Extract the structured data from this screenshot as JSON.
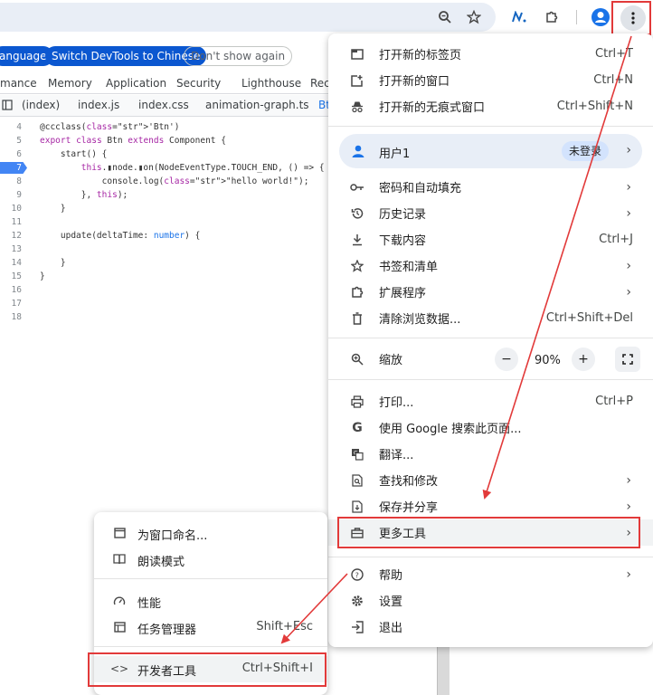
{
  "banner": {
    "set_language_label": "anguage",
    "switch_chinese_label": "Switch DevTools to Chinese",
    "dont_show_label": "Don't show again"
  },
  "devtools": {
    "panel_tabs": [
      "mance",
      "Memory",
      "Application",
      "Security",
      "Lighthouse",
      "Rec"
    ],
    "file_tabs": [
      "(index)",
      "index.js",
      "index.css",
      "animation-graph.ts",
      "Bt"
    ],
    "code_lines": [
      {
        "n": "4",
        "t": "@ccclass('Btn')"
      },
      {
        "n": "5",
        "t": "export class Btn extends Component {"
      },
      {
        "n": "6",
        "t": "    start() {"
      },
      {
        "n": "7",
        "t": "        this.▮node.▮on(NodeEventType.TOUCH_END, () => {"
      },
      {
        "n": "8",
        "t": "            console.log(\"hello world!\");"
      },
      {
        "n": "9",
        "t": "        }, this);"
      },
      {
        "n": "10",
        "t": "    }"
      },
      {
        "n": "11",
        "t": ""
      },
      {
        "n": "12",
        "t": "    update(deltaTime: number) {"
      },
      {
        "n": "13",
        "t": ""
      },
      {
        "n": "14",
        "t": "    }"
      },
      {
        "n": "15",
        "t": "}"
      },
      {
        "n": "16",
        "t": ""
      },
      {
        "n": "17",
        "t": ""
      },
      {
        "n": "18",
        "t": ""
      }
    ]
  },
  "menu": {
    "new_tab": {
      "label": "打开新的标签页",
      "shortcut": "Ctrl+T"
    },
    "new_window": {
      "label": "打开新的窗口",
      "shortcut": "Ctrl+N"
    },
    "incognito": {
      "label": "打开新的无痕式窗口",
      "shortcut": "Ctrl+Shift+N"
    },
    "profile": {
      "name": "用户1",
      "status": "未登录"
    },
    "passwords": {
      "label": "密码和自动填充"
    },
    "history": {
      "label": "历史记录"
    },
    "downloads": {
      "label": "下载内容",
      "shortcut": "Ctrl+J"
    },
    "bookmarks": {
      "label": "书签和清单"
    },
    "extensions": {
      "label": "扩展程序"
    },
    "clear_data": {
      "label": "清除浏览数据...",
      "shortcut": "Ctrl+Shift+Del"
    },
    "zoom": {
      "label": "缩放",
      "value": "90%",
      "minus": "−",
      "plus": "+"
    },
    "print": {
      "label": "打印...",
      "shortcut": "Ctrl+P"
    },
    "google_search": {
      "label": "使用 Google 搜索此页面..."
    },
    "translate": {
      "label": "翻译..."
    },
    "find_edit": {
      "label": "查找和修改"
    },
    "save_share": {
      "label": "保存并分享"
    },
    "more_tools": {
      "label": "更多工具"
    },
    "help": {
      "label": "帮助"
    },
    "settings": {
      "label": "设置"
    },
    "exit": {
      "label": "退出"
    }
  },
  "submenu": {
    "name_window": {
      "label": "为窗口命名..."
    },
    "reading_mode": {
      "label": "朗读模式"
    },
    "performance": {
      "label": "性能"
    },
    "task_manager": {
      "label": "任务管理器",
      "shortcut": "Shift+Esc"
    },
    "devtools": {
      "label": "开发者工具",
      "shortcut": "Ctrl+Shift+I"
    }
  },
  "colors": {
    "annotation_red": "#e23a3a",
    "accent_blue": "#0b57d0",
    "profile_bg": "#e8eef7"
  },
  "icons": {
    "toolbar": [
      "zoom-icon",
      "star-icon",
      "extension-n-icon",
      "puzzle-icon",
      "avatar-icon",
      "kebab-menu-icon"
    ]
  }
}
